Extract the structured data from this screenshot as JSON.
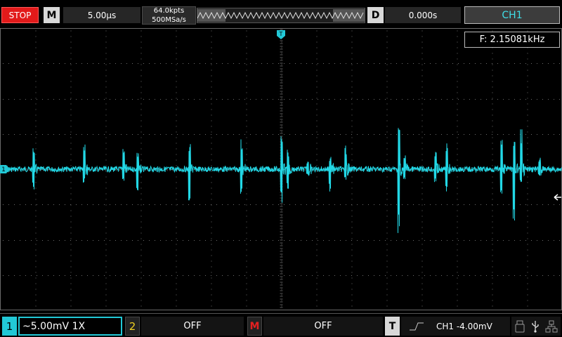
{
  "topbar": {
    "run_state": "STOP",
    "mode_key": "M",
    "timebase": "5.00µs",
    "memory_depth": "64.0kpts",
    "sample_rate": "500MSa/s",
    "delay_key": "D",
    "delay_value": "0.000s",
    "trigger_source": "CH1"
  },
  "screen": {
    "frequency_readout": "F: 2.15081kHz",
    "trigger_position_marker": "T",
    "ch1_ground_marker": "1"
  },
  "bottombar": {
    "ch1_number": "1",
    "ch1_setting": "~5.00mV  1X",
    "ch2_number": "2",
    "ch2_state": "OFF",
    "math_key": "M",
    "math_state": "OFF",
    "trigger_key": "T",
    "trigger_setting": "CH1  -4.00mV"
  },
  "colors": {
    "ch1": "#22d8e6",
    "ch2": "#f0d020",
    "math": "#e22020",
    "stop": "#e21a1a"
  },
  "icons": [
    "sine-icon",
    "rising-edge-icon",
    "usb-drive-icon",
    "usb-icon",
    "network-icon"
  ]
}
